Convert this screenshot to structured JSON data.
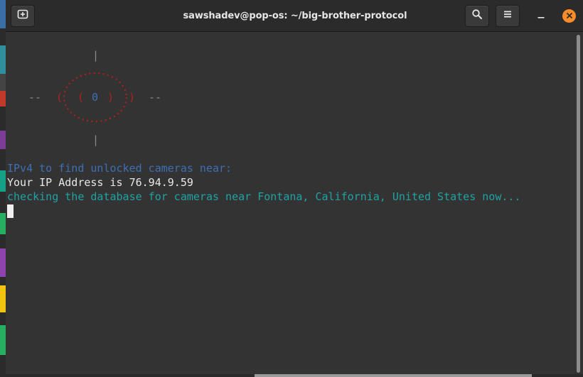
{
  "window": {
    "title": "sawshadev@pop-os: ~/big-brother-protocol"
  },
  "headerbar": {
    "new_tab_icon": "new-tab-icon",
    "search_icon": "search-icon",
    "menu_icon": "hamburger-menu-icon",
    "minimize_icon": "minimize-icon",
    "close_icon": "close-icon",
    "close_color": "#fb8c2a"
  },
  "terminal": {
    "ascii_art": [
      {
        "text": "            |",
        "color": "gray"
      },
      {
        "text": "          .-\"-\"-.",
        "color": "red"
      },
      {
        "text": "        .'       '.",
        "color": "red"
      },
      {
        "text": "  --  (  (  0  )  )  --",
        "color": "mixed"
      },
      {
        "text": "        '.       .'",
        "color": "red"
      },
      {
        "text": "          '-._.-'",
        "color": "red"
      },
      {
        "text": "            |",
        "color": "gray"
      }
    ],
    "eye_pupil": "0",
    "dash_left": "--",
    "dash_right": "--",
    "prompt_line": "IPv4 to find unlocked cameras near:",
    "ip_line": "Your IP Address is 76.94.9.59",
    "checking_line": "checking the database for cameras near Fontana, California, United States now...",
    "colors": {
      "ascii_gray": "#8a8a8a",
      "ascii_red": "#b21f1f",
      "prompt_blue": "#3f6fb3",
      "ip_white": "#e8e8e8",
      "checking_cyan": "#1fa3a3"
    }
  }
}
